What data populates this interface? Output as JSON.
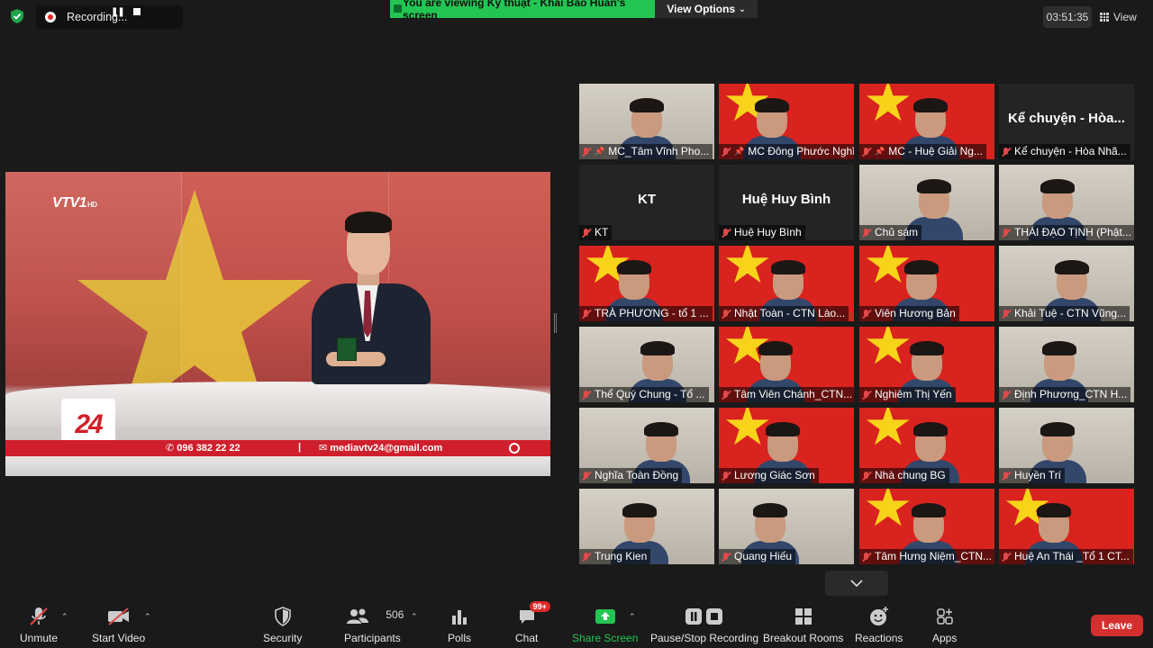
{
  "top": {
    "recording_label": "Recording...",
    "viewing_text": "You are viewing Kỹ thuật - Khải Bảo Huấn's screen",
    "view_options_label": "View Options",
    "timer": "03:51:35",
    "view_label": "View"
  },
  "shared_screen": {
    "channel_logo": "VTV1",
    "channel_badge": "HD",
    "program_logo": "24",
    "phone": "096 382 22 22",
    "email": "mediavtv24@gmail.com"
  },
  "gallery": {
    "tiles": [
      {
        "name": "MC_Tâm Vĩnh Pho...",
        "big_name": "",
        "bg": "room",
        "pinned": true
      },
      {
        "name": "MC Đông Phước Nghĩa",
        "big_name": "",
        "bg": "flag",
        "pinned": true
      },
      {
        "name": "MC - Huệ Giải Ng...",
        "big_name": "",
        "bg": "flag",
        "pinned": true,
        "active": true
      },
      {
        "name": "Kể chuyện - Hòa Nhã...",
        "big_name": "Kể chuyện - Hòa...",
        "bg": "dark"
      },
      {
        "name": "KT",
        "big_name": "KT",
        "bg": "dark"
      },
      {
        "name": "Huệ Huy Bình",
        "big_name": "Huệ Huy Bình",
        "bg": "dark"
      },
      {
        "name": "Chủ sám",
        "big_name": "",
        "bg": "room"
      },
      {
        "name": "THÁI ĐẠO TỊNH (Phật...",
        "big_name": "",
        "bg": "room"
      },
      {
        "name": "TRÀ PHƯƠNG - tổ 1 ...",
        "big_name": "",
        "bg": "flag"
      },
      {
        "name": "Nhật Toàn - CTN Lào...",
        "big_name": "",
        "bg": "flag"
      },
      {
        "name": "Viên Hương Bản",
        "big_name": "",
        "bg": "flag"
      },
      {
        "name": "Khải Tuệ - CTN Vũng...",
        "big_name": "",
        "bg": "room"
      },
      {
        "name": "Thể Quý Chung - Tổ ...",
        "big_name": "",
        "bg": "room"
      },
      {
        "name": "Tâm Viên Chánh_CTN...",
        "big_name": "",
        "bg": "flag"
      },
      {
        "name": "Nghiêm Thị Yến",
        "big_name": "",
        "bg": "flag"
      },
      {
        "name": "Định Phương_CTN H...",
        "big_name": "",
        "bg": "room"
      },
      {
        "name": "Nghĩa Toàn Đồng",
        "big_name": "",
        "bg": "room"
      },
      {
        "name": "Lương Giác Sơn",
        "big_name": "",
        "bg": "flag"
      },
      {
        "name": "Nhà chung BG",
        "big_name": "",
        "bg": "flag"
      },
      {
        "name": "Huyền Trí",
        "big_name": "",
        "bg": "room"
      },
      {
        "name": "Trung Kien",
        "big_name": "",
        "bg": "room"
      },
      {
        "name": "Quang Hiếu",
        "big_name": "",
        "bg": "room"
      },
      {
        "name": "Tâm Hưng Niệm_CTN...",
        "big_name": "",
        "bg": "flag"
      },
      {
        "name": "Huệ An Thái _Tổ 1 CT...",
        "big_name": "",
        "bg": "flag"
      }
    ]
  },
  "toolbar": {
    "unmute": "Unmute",
    "start_video": "Start Video",
    "security": "Security",
    "participants": "Participants",
    "participants_count": "506",
    "polls": "Polls",
    "chat": "Chat",
    "chat_badge": "99+",
    "share_screen": "Share Screen",
    "pause_stop_recording": "Pause/Stop Recording",
    "breakout_rooms": "Breakout Rooms",
    "reactions": "Reactions",
    "apps": "Apps",
    "leave": "Leave"
  },
  "colors": {
    "share_green": "#23c552",
    "leave_red": "#d42f2f",
    "active_speaker": "#b3d64d",
    "flag_red": "#d8231f",
    "flag_star": "#f7d31a"
  }
}
